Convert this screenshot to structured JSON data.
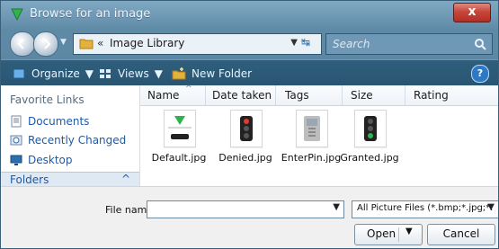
{
  "window": {
    "title": "Browse for an image",
    "close_label": "x"
  },
  "navbar": {
    "address": {
      "prefix": "«",
      "location": "Image Library"
    },
    "search": {
      "placeholder": "Search"
    }
  },
  "toolbar": {
    "organize": "Organize",
    "views": "Views",
    "new_folder": "New Folder",
    "help_glyph": "?"
  },
  "left_pane": {
    "header": "Favorite Links",
    "links": [
      "Documents",
      "Recently Changed",
      "Desktop"
    ],
    "folders_label": "Folders"
  },
  "file_list": {
    "columns": [
      "Name",
      "Date taken",
      "Tags",
      "Size",
      "Rating"
    ],
    "files": [
      {
        "name": "Default.jpg",
        "icon": "default-image-icon"
      },
      {
        "name": "Denied.jpg",
        "icon": "denied-image-icon"
      },
      {
        "name": "EnterPin.jpg",
        "icon": "enterpin-image-icon"
      },
      {
        "name": "Granted.jpg",
        "icon": "granted-image-icon"
      }
    ]
  },
  "footer": {
    "file_name_label": "File name:",
    "file_name_value": "",
    "file_type_filter": "All Picture Files (*.bmp;*.jpg;*.",
    "open_label": "Open",
    "cancel_label": "Cancel"
  },
  "colors": {
    "title_bar": "#5f8aa6",
    "close_button": "#c6463a",
    "toolbar": "#2f5f7d",
    "link_blue": "#1e5aa6"
  }
}
